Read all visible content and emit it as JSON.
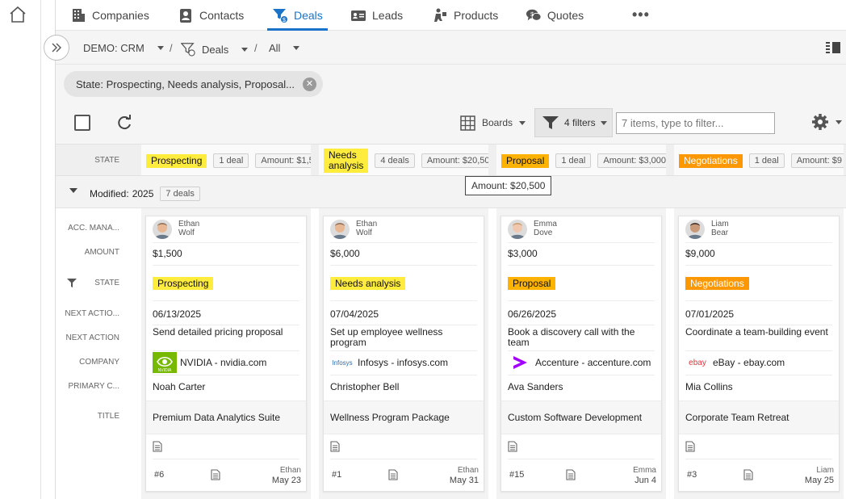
{
  "nav": {
    "items": [
      {
        "label": "Companies",
        "icon": "building-icon"
      },
      {
        "label": "Contacts",
        "icon": "contact-card-icon"
      },
      {
        "label": "Deals",
        "icon": "deals-funnel-icon"
      },
      {
        "label": "Leads",
        "icon": "id-card-icon"
      },
      {
        "label": "Products",
        "icon": "products-icon"
      },
      {
        "label": "Quotes",
        "icon": "quotes-chat-icon"
      }
    ],
    "active": "Deals",
    "more": "•••"
  },
  "breadcrumb": {
    "workspace": "DEMO: CRM",
    "sep1": "/",
    "entity": "Deals",
    "sep2": "/",
    "view": "All"
  },
  "filter_chip": {
    "label": "State: Prospecting, Needs analysis, Proposal...",
    "close": "✕"
  },
  "toolbar": {
    "boards_label": "Boards",
    "filters_label": "4 filters",
    "filter_placeholder": "7 items, type to filter..."
  },
  "state_row": {
    "label": "STATE",
    "columns": [
      {
        "state": "Prospecting",
        "color": "#ffec3d",
        "count": "1 deal",
        "amount": "Amount: $1,5"
      },
      {
        "state": "Needs analysis",
        "color": "#ffec3d",
        "count": "4 deals",
        "amount": "Amount: $20,50"
      },
      {
        "state": "Proposal",
        "color": "#ffb300",
        "count": "1 deal",
        "amount": "Amount: $3,000"
      },
      {
        "state": "Negotiations",
        "color": "#ff9800",
        "count": "1 deal",
        "amount": "Amount: $9"
      }
    ]
  },
  "tooltip": "Amount: $20,500",
  "group": {
    "label": "Modified:",
    "value": "2025",
    "count": "7 deals"
  },
  "row_labels": {
    "manager": "ACC. MANA...",
    "amount": "AMOUNT",
    "state": "STATE",
    "next_action_date": "NEXT ACTIO...",
    "next_action": "NEXT ACTION",
    "company": "COMPANY",
    "contact": "PRIMARY C...",
    "title": "TITLE"
  },
  "cards": [
    {
      "manager_first": "Ethan",
      "manager_last": "Wolf",
      "amount": "$1,500",
      "state": "Prospecting",
      "state_color": "#ffec3d",
      "date": "06/13/2025",
      "action": "Send detailed pricing proposal",
      "company": "NVIDIA - nvidia.com",
      "logo": "nvidia",
      "logo_text": "NVIDIA",
      "contact": "Noah Carter",
      "title": "Premium Data Analytics Suite",
      "id": "#6",
      "owner": "Ethan",
      "modified": "May 23"
    },
    {
      "manager_first": "Ethan",
      "manager_last": "Wolf",
      "amount": "$6,000",
      "state": "Needs analysis",
      "state_color": "#ffec3d",
      "date": "07/04/2025",
      "action": "Set up employee wellness program",
      "company": "Infosys - infosys.com",
      "logo": "infosys",
      "logo_text": "Infosys",
      "contact": "Christopher Bell",
      "title": "Wellness Program Package",
      "id": "#1",
      "owner": "Ethan",
      "modified": "May 31"
    },
    {
      "manager_first": "Emma",
      "manager_last": "Dove",
      "amount": "$3,000",
      "state": "Proposal",
      "state_color": "#ffb300",
      "date": "06/26/2025",
      "action": "Book a discovery call with the team",
      "company": "Accenture - accenture.com",
      "logo": "accenture",
      "logo_text": "",
      "contact": "Ava Sanders",
      "title": "Custom Software Development",
      "id": "#15",
      "owner": "Emma",
      "modified": "Jun 4"
    },
    {
      "manager_first": "Liam",
      "manager_last": "Bear",
      "amount": "$9,000",
      "state": "Negotiations",
      "state_color": "#ff9800",
      "date": "07/01/2025",
      "action": "Coordinate a team-building event",
      "company": "eBay - ebay.com",
      "logo": "ebay",
      "logo_text": "ebay",
      "contact": "Mia Collins",
      "title": "Corporate Team Retreat",
      "id": "#3",
      "owner": "Liam",
      "modified": "May 25"
    }
  ]
}
